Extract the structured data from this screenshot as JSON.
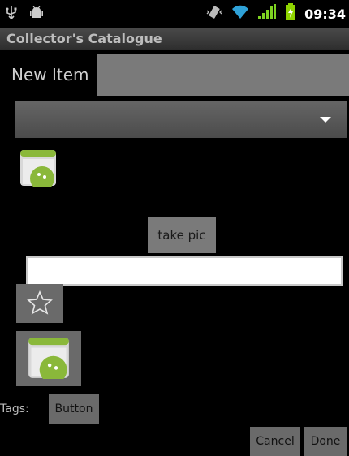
{
  "status_bar": {
    "time": "09:34",
    "icons": [
      "usb-icon",
      "android-debug-icon",
      "vibrate-icon",
      "wifi-icon",
      "signal-icon",
      "battery-charging-icon"
    ]
  },
  "app": {
    "title": "Collector's Catalogue"
  },
  "form": {
    "new_item_label": "New Item",
    "new_item_value": "",
    "spinner_value": "",
    "take_pic_label": "take pic",
    "text_field_value": "",
    "tags_label": "Tags:",
    "tags_button_label": "Button",
    "cancel_label": "Cancel",
    "done_label": "Done"
  },
  "colors": {
    "background": "#000000",
    "button": "#6a6a6a",
    "android_green": "#8ab83a"
  }
}
